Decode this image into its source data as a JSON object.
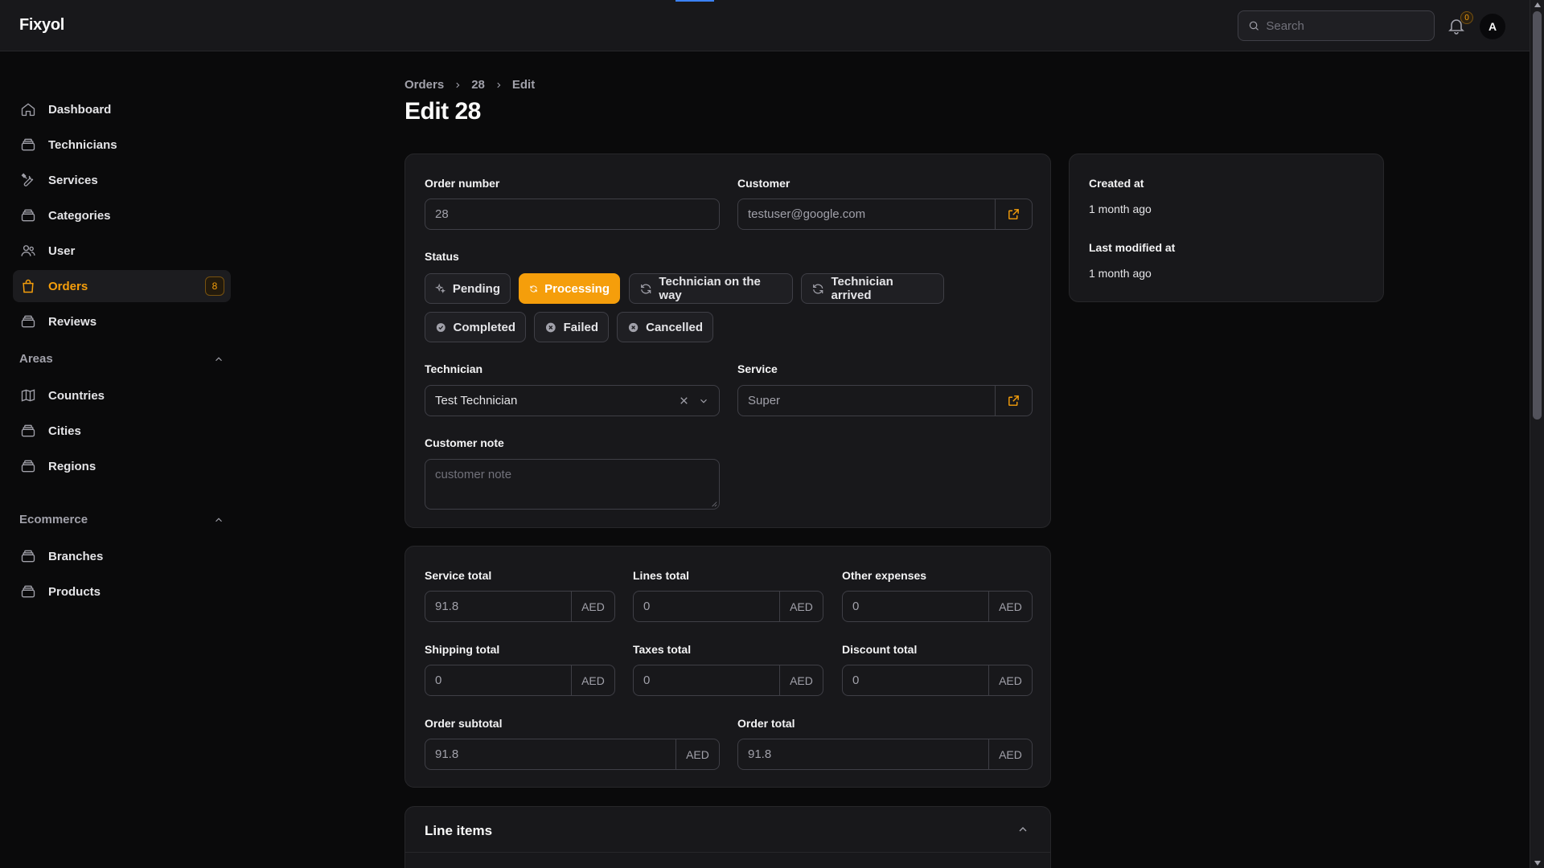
{
  "app": {
    "brand": "Fixyol"
  },
  "topbar": {
    "search_placeholder": "Search",
    "notification_count": "0",
    "avatar_initial": "A"
  },
  "sidebar": {
    "items": [
      {
        "label": "Dashboard",
        "icon": "home-icon"
      },
      {
        "label": "Technicians",
        "icon": "stack-icon"
      },
      {
        "label": "Services",
        "icon": "wrench-screwdriver-icon"
      },
      {
        "label": "Categories",
        "icon": "stack-icon"
      },
      {
        "label": "User",
        "icon": "users-icon"
      },
      {
        "label": "Orders",
        "icon": "shopping-bag-icon",
        "badge": "8",
        "active": true
      },
      {
        "label": "Reviews",
        "icon": "stack-icon"
      }
    ],
    "groups": [
      {
        "label": "Areas",
        "items": [
          {
            "label": "Countries",
            "icon": "map-icon"
          },
          {
            "label": "Cities",
            "icon": "stack-icon"
          },
          {
            "label": "Regions",
            "icon": "stack-icon"
          }
        ]
      },
      {
        "label": "Ecommerce",
        "items": [
          {
            "label": "Branches",
            "icon": "stack-icon"
          },
          {
            "label": "Products",
            "icon": "stack-icon"
          }
        ]
      }
    ]
  },
  "breadcrumb": [
    "Orders",
    "28",
    "Edit"
  ],
  "page_title": "Edit 28",
  "form": {
    "order_number": {
      "label": "Order number",
      "value": "28"
    },
    "customer": {
      "label": "Customer",
      "value": "testuser@google.com"
    },
    "status": {
      "label": "Status",
      "options": [
        "Pending",
        "Processing",
        "Technician on the way",
        "Technician arrived",
        "Completed",
        "Failed",
        "Cancelled"
      ],
      "selected": "Processing"
    },
    "technician": {
      "label": "Technician",
      "value": "Test Technician"
    },
    "service": {
      "label": "Service",
      "value": "Super"
    },
    "customer_note": {
      "label": "Customer note",
      "placeholder": "customer note"
    }
  },
  "totals": {
    "currency": "AED",
    "service_total": {
      "label": "Service total",
      "value": "91.8"
    },
    "lines_total": {
      "label": "Lines total",
      "value": "0"
    },
    "other_expenses": {
      "label": "Other expenses",
      "value": "0"
    },
    "shipping_total": {
      "label": "Shipping total",
      "value": "0"
    },
    "taxes_total": {
      "label": "Taxes total",
      "value": "0"
    },
    "discount_total": {
      "label": "Discount total",
      "value": "0"
    },
    "order_subtotal": {
      "label": "Order subtotal",
      "value": "91.8"
    },
    "order_total": {
      "label": "Order total",
      "value": "91.8"
    }
  },
  "meta": {
    "created_label": "Created at",
    "created_value": "1 month ago",
    "modified_label": "Last modified at",
    "modified_value": "1 month ago"
  },
  "line_items": {
    "title": "Line items"
  },
  "colors": {
    "accent": "#f59e0b",
    "background": "#0a0a0b",
    "card": "#18181b",
    "border": "#3f3f46"
  }
}
